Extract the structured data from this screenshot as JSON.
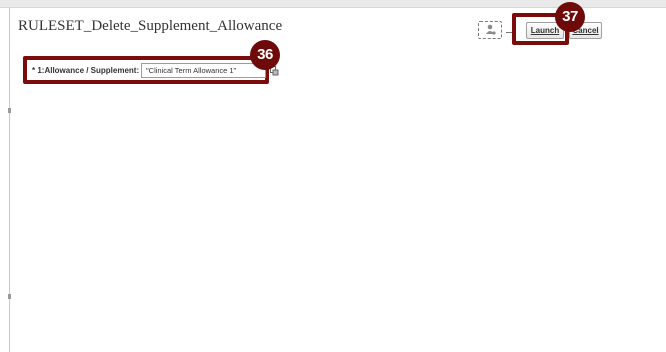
{
  "page": {
    "title": "RULESET_Delete_Supplement_Allowance"
  },
  "parameters": {
    "allowance_label": "* 1:Allowance / Supplement:",
    "allowance_value": "\"Clinical Term Allowance 1\""
  },
  "actions": {
    "launch_label": "Launch",
    "cancel_label": "Cancel"
  },
  "callouts": {
    "field_step": "36",
    "launch_step": "37"
  },
  "colors": {
    "callout": "#7a0c0c"
  },
  "icons": {
    "person": "person-icon",
    "lookup": "lookup-icon"
  }
}
